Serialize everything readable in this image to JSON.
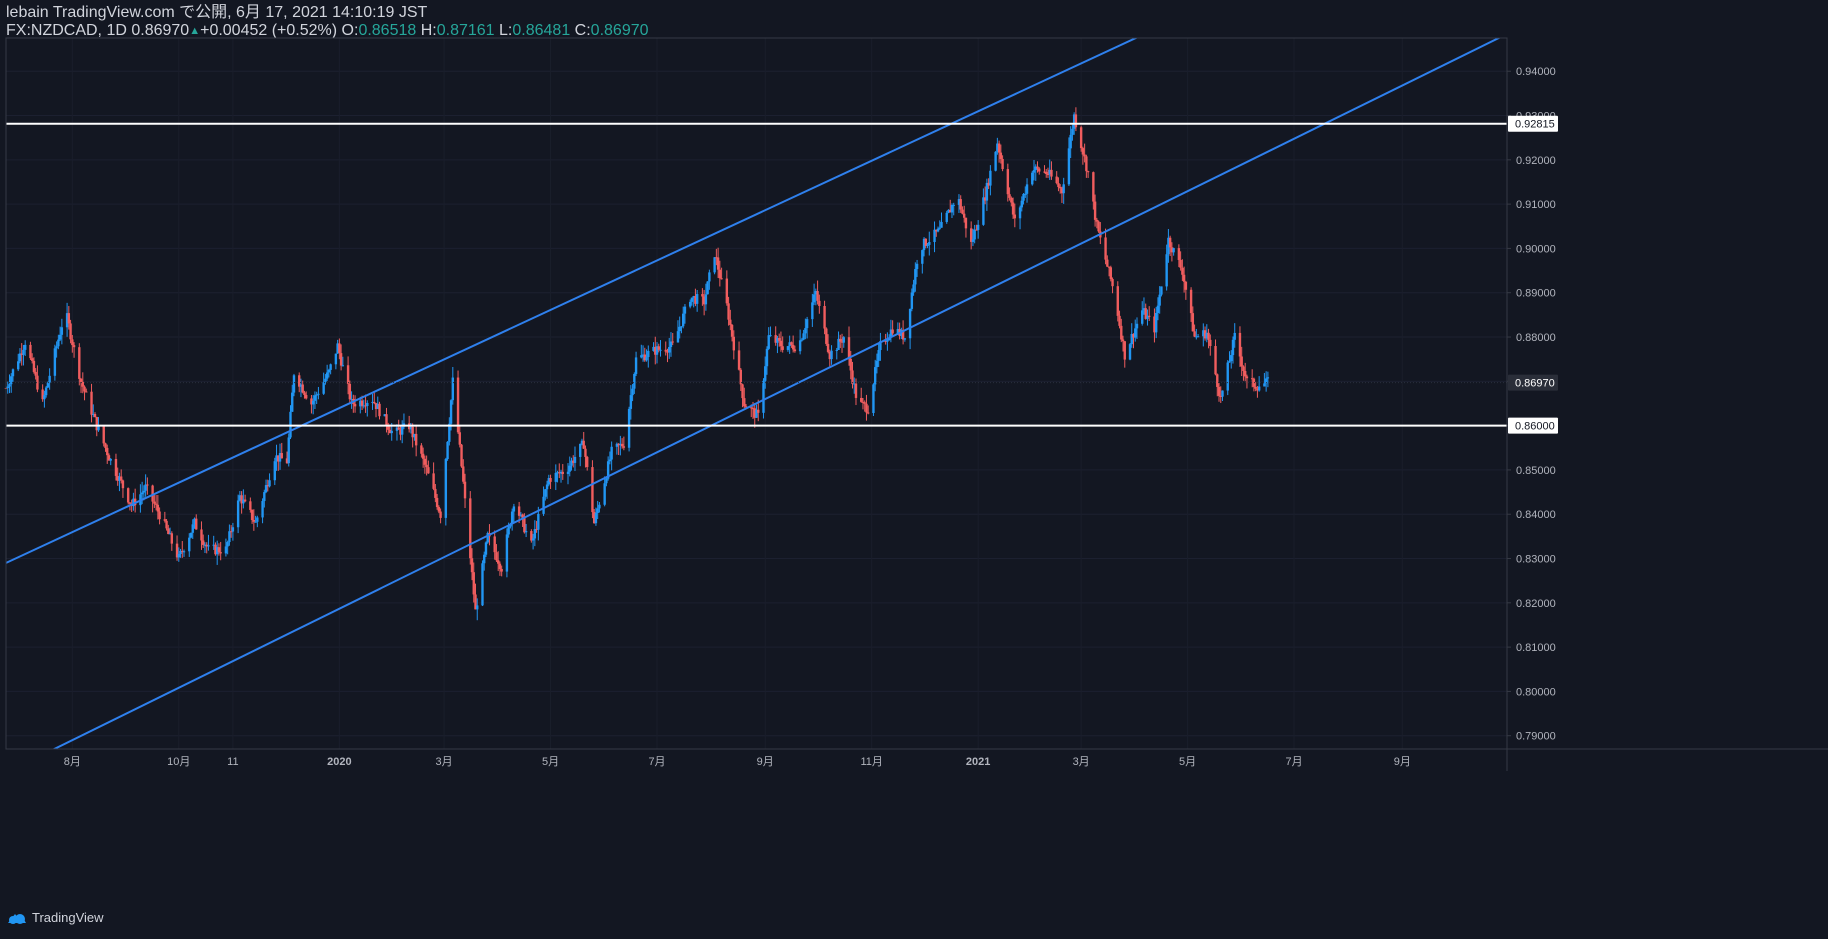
{
  "header": {
    "publish_line": "lebain TradingView.com で公開, 6月 17, 2021 14:10:19 JST",
    "symbol": "FX:NZDCAD, 1D",
    "last": "0.86970",
    "arrow": "▲",
    "change": "+0.00452 (+0.52%)",
    "o_label": "O:",
    "o_val": "0.86518",
    "h_label": "H:",
    "h_val": "0.87161",
    "l_label": "L:",
    "l_val": "0.86481",
    "c_label": "C:",
    "c_val": "0.86970"
  },
  "footer": {
    "brand": "TradingView"
  },
  "colors": {
    "background": "#131722",
    "up": "#2196f3",
    "down": "#f05d5e",
    "channel": "#2f80ed",
    "hline": "#ffffff",
    "text": "#d1d4dc"
  },
  "chart_data": {
    "type": "candlestick",
    "symbol": "NZDCAD",
    "timeframe": "1D",
    "yticks": [
      "0.94000",
      "0.93000",
      "0.92000",
      "0.91000",
      "0.90000",
      "0.89000",
      "0.88000",
      "0.87000",
      "0.86000",
      "0.85000",
      "0.84000",
      "0.83000",
      "0.82000",
      "0.81000",
      "0.80000",
      "0.79000"
    ],
    "ylim": [
      0.787,
      0.9475
    ],
    "xlim": [
      "2019-06-24",
      "2021-10-31"
    ],
    "xticks": [
      {
        "label": "8月",
        "date": "2019-08-01"
      },
      {
        "label": "10月",
        "date": "2019-10-01"
      },
      {
        "label": "11",
        "date": "2019-11-01"
      },
      {
        "label": "2020",
        "date": "2020-01-01"
      },
      {
        "label": "3月",
        "date": "2020-03-01"
      },
      {
        "label": "5月",
        "date": "2020-05-01"
      },
      {
        "label": "7月",
        "date": "2020-07-01"
      },
      {
        "label": "9月",
        "date": "2020-09-01"
      },
      {
        "label": "11月",
        "date": "2020-11-01"
      },
      {
        "label": "2021",
        "date": "2021-01-01"
      },
      {
        "label": "3月",
        "date": "2021-03-01"
      },
      {
        "label": "5月",
        "date": "2021-05-01"
      },
      {
        "label": "7月",
        "date": "2021-07-01"
      },
      {
        "label": "9月",
        "date": "2021-09-01"
      }
    ],
    "price_labels": [
      {
        "value": 0.92815,
        "text": "0.92815",
        "style": "white"
      },
      {
        "value": 0.8697,
        "text": "0.86970",
        "style": "dark"
      },
      {
        "value": 0.86,
        "text": "0.86000",
        "style": "white"
      }
    ],
    "horizontal_lines": [
      0.92815,
      0.86
    ],
    "channel_lines": [
      {
        "p1": {
          "date": "2019-06-24",
          "value": 0.829
        },
        "p2": {
          "date": "2021-04-15",
          "value": 0.95
        }
      },
      {
        "p1": {
          "date": "2019-08-01",
          "value": 0.789
        },
        "p2": {
          "date": "2021-06-24",
          "value": 0.9234
        }
      }
    ],
    "path": [
      {
        "date": "2019-06-24",
        "value": 0.8685
      },
      {
        "date": "2019-07-05",
        "value": 0.879
      },
      {
        "date": "2019-07-15",
        "value": 0.865
      },
      {
        "date": "2019-07-28",
        "value": 0.886
      },
      {
        "date": "2019-08-06",
        "value": 0.87
      },
      {
        "date": "2019-08-15",
        "value": 0.86
      },
      {
        "date": "2019-08-22",
        "value": 0.853
      },
      {
        "date": "2019-09-04",
        "value": 0.842
      },
      {
        "date": "2019-09-12",
        "value": 0.846
      },
      {
        "date": "2019-09-20",
        "value": 0.84
      },
      {
        "date": "2019-10-01",
        "value": 0.83
      },
      {
        "date": "2019-10-10",
        "value": 0.838
      },
      {
        "date": "2019-10-18",
        "value": 0.832
      },
      {
        "date": "2019-10-28",
        "value": 0.832
      },
      {
        "date": "2019-11-05",
        "value": 0.844
      },
      {
        "date": "2019-11-14",
        "value": 0.838
      },
      {
        "date": "2019-11-25",
        "value": 0.853
      },
      {
        "date": "2019-12-02",
        "value": 0.852
      },
      {
        "date": "2019-12-06",
        "value": 0.872
      },
      {
        "date": "2019-12-16",
        "value": 0.865
      },
      {
        "date": "2019-12-26",
        "value": 0.872
      },
      {
        "date": "2019-12-31",
        "value": 0.878
      },
      {
        "date": "2020-01-08",
        "value": 0.865
      },
      {
        "date": "2020-01-20",
        "value": 0.866
      },
      {
        "date": "2020-02-01",
        "value": 0.858
      },
      {
        "date": "2020-02-10",
        "value": 0.86
      },
      {
        "date": "2020-02-20",
        "value": 0.85
      },
      {
        "date": "2020-02-28",
        "value": 0.84
      },
      {
        "date": "2020-03-06",
        "value": 0.87
      },
      {
        "date": "2020-03-12",
        "value": 0.847
      },
      {
        "date": "2020-03-19",
        "value": 0.818
      },
      {
        "date": "2020-03-26",
        "value": 0.835
      },
      {
        "date": "2020-04-03",
        "value": 0.828
      },
      {
        "date": "2020-04-10",
        "value": 0.843
      },
      {
        "date": "2020-04-20",
        "value": 0.833
      },
      {
        "date": "2020-04-30",
        "value": 0.848
      },
      {
        "date": "2020-05-10",
        "value": 0.85
      },
      {
        "date": "2020-05-20",
        "value": 0.856
      },
      {
        "date": "2020-05-26",
        "value": 0.838
      },
      {
        "date": "2020-06-05",
        "value": 0.854
      },
      {
        "date": "2020-06-12",
        "value": 0.856
      },
      {
        "date": "2020-06-19",
        "value": 0.875
      },
      {
        "date": "2020-06-30",
        "value": 0.877
      },
      {
        "date": "2020-07-10",
        "value": 0.878
      },
      {
        "date": "2020-07-20",
        "value": 0.889
      },
      {
        "date": "2020-07-28",
        "value": 0.888
      },
      {
        "date": "2020-08-03",
        "value": 0.899
      },
      {
        "date": "2020-08-10",
        "value": 0.887
      },
      {
        "date": "2020-08-20",
        "value": 0.865
      },
      {
        "date": "2020-08-28",
        "value": 0.862
      },
      {
        "date": "2020-09-03",
        "value": 0.88
      },
      {
        "date": "2020-09-11",
        "value": 0.878
      },
      {
        "date": "2020-09-20",
        "value": 0.878
      },
      {
        "date": "2020-09-30",
        "value": 0.89
      },
      {
        "date": "2020-10-08",
        "value": 0.876
      },
      {
        "date": "2020-10-16",
        "value": 0.88
      },
      {
        "date": "2020-10-24",
        "value": 0.865
      },
      {
        "date": "2020-10-30",
        "value": 0.864
      },
      {
        "date": "2020-11-06",
        "value": 0.878
      },
      {
        "date": "2020-11-13",
        "value": 0.882
      },
      {
        "date": "2020-11-20",
        "value": 0.88
      },
      {
        "date": "2020-11-28",
        "value": 0.9
      },
      {
        "date": "2020-12-10",
        "value": 0.904
      },
      {
        "date": "2020-12-20",
        "value": 0.912
      },
      {
        "date": "2020-12-28",
        "value": 0.901
      },
      {
        "date": "2021-01-05",
        "value": 0.912
      },
      {
        "date": "2021-01-12",
        "value": 0.924
      },
      {
        "date": "2021-01-22",
        "value": 0.906
      },
      {
        "date": "2021-02-01",
        "value": 0.918
      },
      {
        "date": "2021-02-10",
        "value": 0.917
      },
      {
        "date": "2021-02-18",
        "value": 0.913
      },
      {
        "date": "2021-02-25",
        "value": 0.93
      },
      {
        "date": "2021-03-05",
        "value": 0.917
      },
      {
        "date": "2021-03-10",
        "value": 0.905
      },
      {
        "date": "2021-03-20",
        "value": 0.89
      },
      {
        "date": "2021-03-26",
        "value": 0.876
      },
      {
        "date": "2021-04-05",
        "value": 0.886
      },
      {
        "date": "2021-04-12",
        "value": 0.882
      },
      {
        "date": "2021-04-20",
        "value": 0.902
      },
      {
        "date": "2021-04-28",
        "value": 0.895
      },
      {
        "date": "2021-05-05",
        "value": 0.88
      },
      {
        "date": "2021-05-12",
        "value": 0.881
      },
      {
        "date": "2021-05-20",
        "value": 0.866
      },
      {
        "date": "2021-05-28",
        "value": 0.88
      },
      {
        "date": "2021-06-04",
        "value": 0.87
      },
      {
        "date": "2021-06-10",
        "value": 0.869
      },
      {
        "date": "2021-06-16",
        "value": 0.8697
      }
    ]
  }
}
